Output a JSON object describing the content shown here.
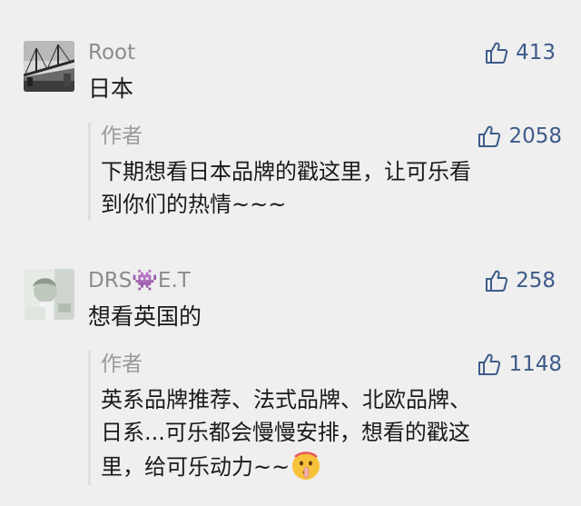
{
  "comments": [
    {
      "username": "Root",
      "likes": "413",
      "text": "日本",
      "reply": {
        "author": "作者",
        "likes": "2058",
        "lines": [
          "下期想看日本品牌的戳这里，让可乐看",
          "到你们的热情~~~"
        ]
      }
    },
    {
      "username": "DRS👾E.T",
      "likes": "258",
      "text": "想看英国的",
      "reply": {
        "author": "作者",
        "likes": "1148",
        "lines": [
          "英系品牌推荐、法式品牌、北欧品牌、",
          "日系...可乐都会慢慢安排，想看的戳这",
          "里，给可乐动力~~"
        ],
        "emoji": "shushing-face-emoji"
      }
    }
  ],
  "icons": {
    "like": "thumbs-up-icon"
  },
  "colors": {
    "background": "#efefef",
    "like_accent": "#3d5b8a",
    "username": "#8c8c8c",
    "text": "#1a1a1a"
  }
}
